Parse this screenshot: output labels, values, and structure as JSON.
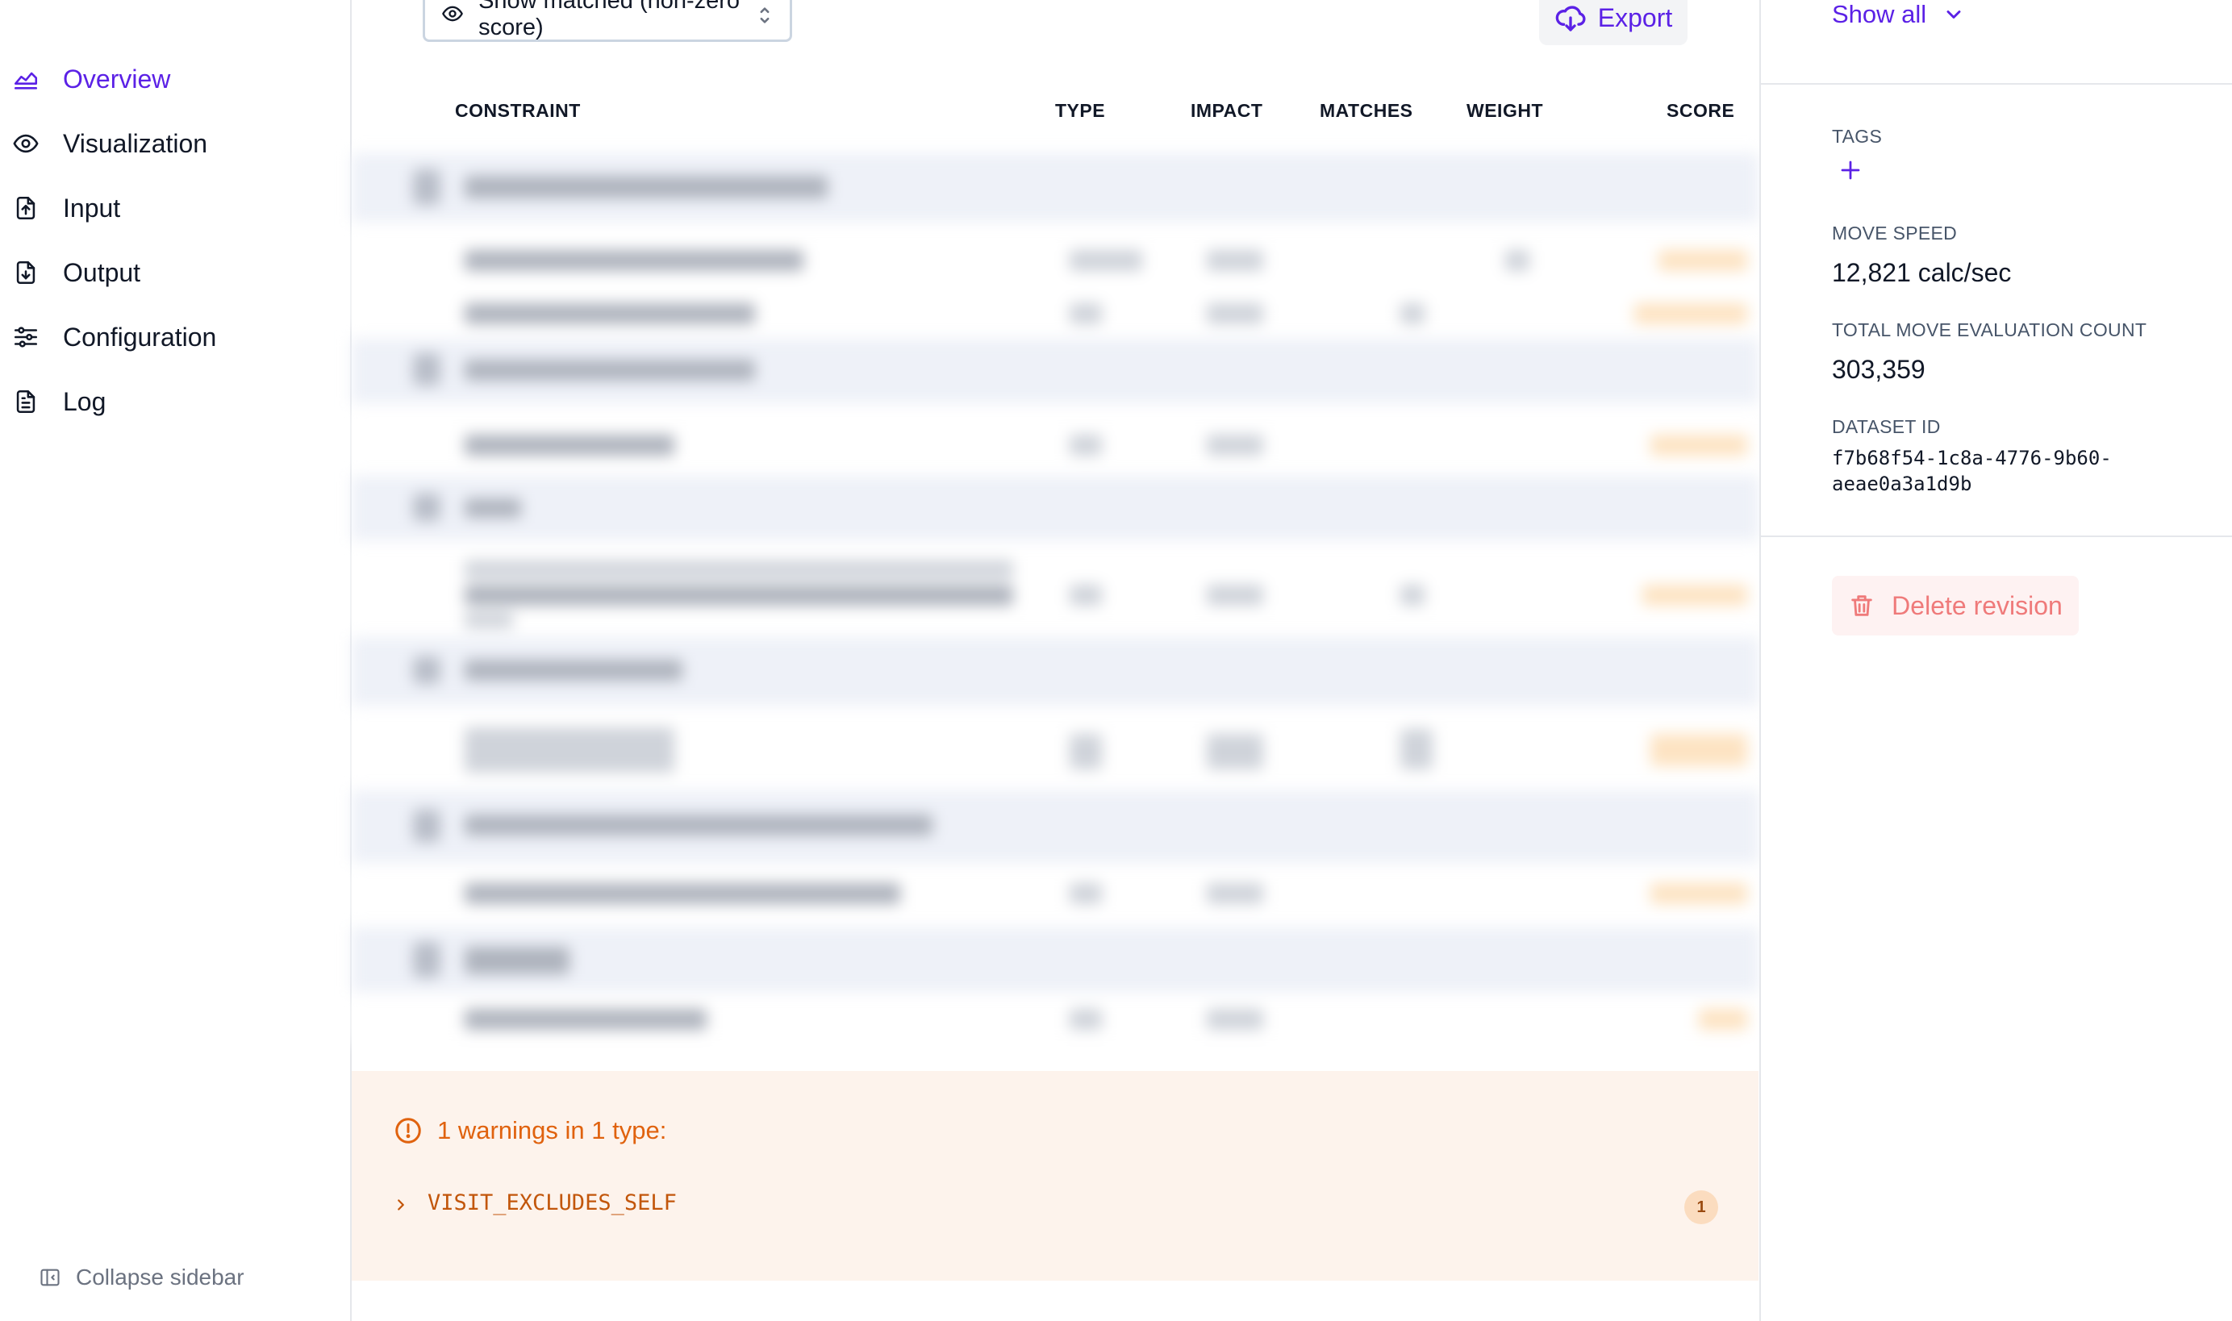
{
  "sidebar": {
    "items": [
      {
        "label": "Overview",
        "icon": "chart-icon",
        "active": true
      },
      {
        "label": "Visualization",
        "icon": "eye-icon",
        "active": false
      },
      {
        "label": "Input",
        "icon": "file-upload-icon",
        "active": false
      },
      {
        "label": "Output",
        "icon": "file-download-icon",
        "active": false
      },
      {
        "label": "Configuration",
        "icon": "sliders-icon",
        "active": false
      },
      {
        "label": "Log",
        "icon": "document-icon",
        "active": false
      }
    ],
    "collapse_label": "Collapse sidebar"
  },
  "toolbar": {
    "filter_value": "Show matched (non-zero score)",
    "export_label": "Export"
  },
  "table": {
    "columns": [
      "CONSTRAINT",
      "TYPE",
      "IMPACT",
      "MATCHES",
      "WEIGHT",
      "SCORE"
    ]
  },
  "warnings": {
    "title": "1 warnings in 1 type:",
    "items": [
      {
        "name": "VISIT_EXCLUDES_SELF",
        "count": "1"
      }
    ]
  },
  "details": {
    "show_all_label": "Show all",
    "tags_label": "TAGS",
    "move_speed_label": "MOVE SPEED",
    "move_speed_value": "12,821 calc/sec",
    "total_moves_label": "TOTAL MOVE EVALUATION COUNT",
    "total_moves_value": "303,359",
    "dataset_id_label": "DATASET ID",
    "dataset_id_value": "f7b68f54-1c8a-4776-9b60-aeae0a3a1d9b",
    "delete_label": "Delete revision"
  },
  "colors": {
    "accent": "#5b21e6",
    "warning": "#e0620e",
    "danger": "#ef7a7a"
  }
}
